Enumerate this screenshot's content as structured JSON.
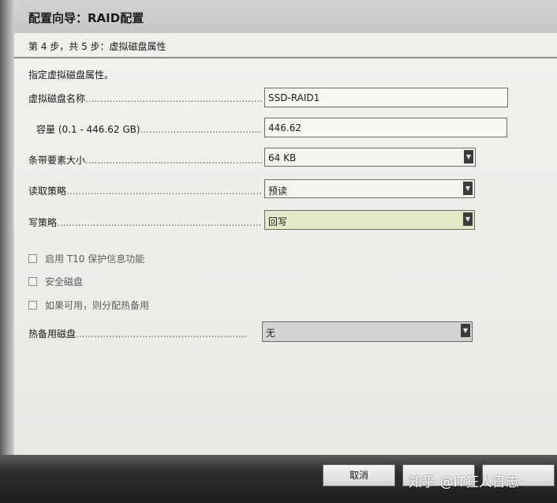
{
  "window": {
    "title": "配置向导：RAID配置"
  },
  "step": {
    "text": "第 4 步，共 5 步：虚拟磁盘属性"
  },
  "section": {
    "title": "指定虚拟磁盘属性。"
  },
  "fields": {
    "vd_name": {
      "label": "虚拟磁盘名称",
      "value": "SSD-RAID1"
    },
    "capacity": {
      "label": "容量 (0.1 - 446.62 GB)",
      "value": "446.62"
    },
    "stripe_size": {
      "label": "条带要素大小",
      "value": "64 KB"
    },
    "read_policy": {
      "label": "读取策略",
      "value": "预读"
    },
    "write_policy": {
      "label": "写策略",
      "value": "回写"
    },
    "hot_spare_disk": {
      "label": "热备用磁盘",
      "value": "无"
    }
  },
  "checkboxes": {
    "t10": {
      "label": "启用 T10 保护信息功能",
      "checked": false
    },
    "secure": {
      "label": "安全磁盘",
      "checked": false
    },
    "hot_spare": {
      "label": "如果可用，则分配热备用",
      "checked": false
    }
  },
  "footer": {
    "cancel_label": "取消"
  },
  "watermark": {
    "text": "知乎 @IT狂人日志"
  },
  "icons": {
    "dropdown": "chevron-down-icon",
    "checkbox": "checkbox-icon"
  },
  "colors": {
    "active_select": "#e6e9c8",
    "footer_bg": "#1e1e1e"
  }
}
